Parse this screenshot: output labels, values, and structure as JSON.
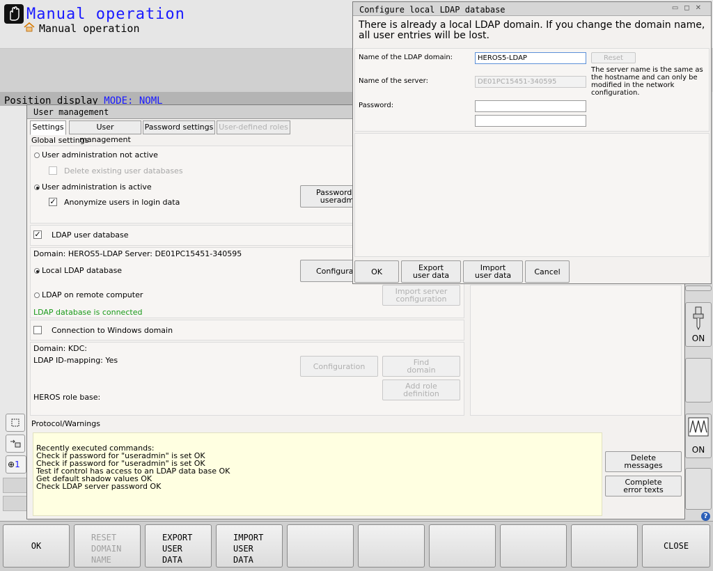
{
  "header": {
    "title": "Manual operation",
    "subtitle": "Manual operation",
    "position_display_label": "Position display",
    "position_display_mode": "MODE: NOML"
  },
  "left_strip": {
    "item_label": "1"
  },
  "right_keys": {
    "on_label_1": "ON",
    "on_label_2": "ON"
  },
  "user_management": {
    "title": "User management",
    "tabs": [
      {
        "label": "Settings"
      },
      {
        "label": "User management"
      },
      {
        "label": "Password settings"
      },
      {
        "label": "User-defined roles"
      }
    ],
    "global_settings_label": "Global settings",
    "admin_not_active": "User administration not active",
    "delete_dbs": "Delete existing user databases",
    "admin_active": "User administration is active",
    "anonymize": "Anonymize users in login data",
    "password_btn": "Password for\nuseradmin",
    "ldap_user_db": "LDAP user database",
    "domain_server": "Domain: HEROS5-LDAP Server: DE01PC15451-340595",
    "local_ldap": "Local LDAP database",
    "ldap_remote": "LDAP on remote computer",
    "configuration_btn": "Configuration",
    "import_server_cfg_btn": "Import server\nconfiguration",
    "connected_status": "LDAP database is connected",
    "windows_domain": "Connection to Windows domain",
    "domain_kdc": "Domain:  KDC:",
    "id_mapping": "LDAP ID-mapping: Yes",
    "heros_role_base": "HEROS role base:",
    "configuration_btn2": "Configuration",
    "find_domain_btn": "Find\ndomain",
    "add_role_btn": "Add role\ndefinition",
    "protocol_label": "Protocol/Warnings",
    "log_lines": [
      "Recently executed commands:",
      "Check if password for \"useradmin\" is set OK",
      "Check if password for \"useradmin\" is set OK",
      "Test if control has access to an LDAP data base OK",
      "Get default shadow values OK",
      "Check LDAP server password OK"
    ],
    "delete_messages_btn": "Delete\nmessages",
    "complete_errors_btn": "Complete\nerror texts"
  },
  "ldap_dialog": {
    "title": "Configure local LDAP database",
    "message": "There is already a local LDAP domain. If you change the domain name, all user entries will be lost.",
    "domain_label": "Name of the LDAP domain:",
    "domain_value": "HEROS5-LDAP",
    "reset_btn": "Reset",
    "server_label": "Name of the server:",
    "server_value": "DE01PC15451-340595",
    "server_note": "The server name is the same as the hostname and can only be modified in the network configuration.",
    "password_label": "Password:",
    "ok_btn": "OK",
    "export_btn": "Export\nuser data",
    "import_btn": "Import\nuser data",
    "cancel_btn": "Cancel"
  },
  "softkeys": {
    "ok": "OK",
    "reset_domain": "RESET\nDOMAIN\nNAME",
    "export_user": "EXPORT\nUSER\nDATA",
    "import_user": "IMPORT\nUSER\nDATA",
    "close": "CLOSE"
  },
  "help_icon": "?"
}
